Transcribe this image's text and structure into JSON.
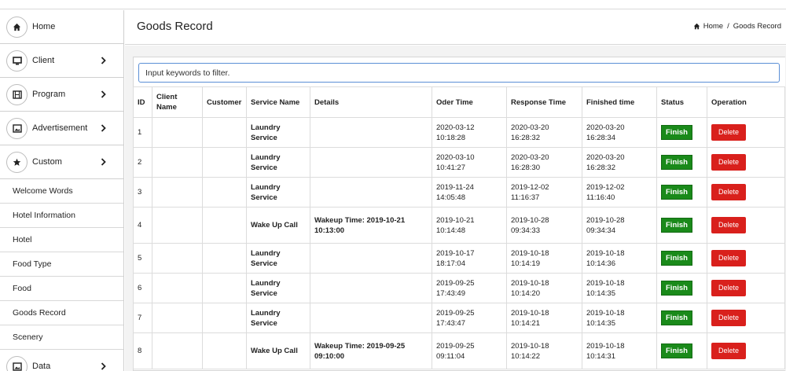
{
  "sidebar": {
    "main_items": [
      {
        "label": "Home",
        "icon": "home-icon"
      },
      {
        "label": "Client",
        "icon": "monitor-icon"
      },
      {
        "label": "Program",
        "icon": "film-icon"
      },
      {
        "label": "Advertisement",
        "icon": "image-icon"
      },
      {
        "label": "Custom",
        "icon": "star-icon"
      }
    ],
    "sub_items": [
      "Welcome Words",
      "Hotel Information",
      "Hotel",
      "Food Type",
      "Food",
      "Goods Record",
      "Scenery"
    ],
    "data_item": {
      "label": "Data",
      "icon": "chart-icon"
    }
  },
  "header": {
    "title": "Goods Record",
    "breadcrumb": {
      "home": "Home",
      "separator": "/",
      "current": "Goods Record"
    }
  },
  "filter": {
    "placeholder": "Input keywords to filter."
  },
  "table": {
    "headers": {
      "id": "ID",
      "client_name": "Client Name",
      "customer": "Customer",
      "service_name": "Service Name",
      "details": "Details",
      "oder_time": "Oder Time",
      "response_time": "Response Time",
      "finished_time": "Finished time",
      "status": "Status",
      "operation": "Operation"
    },
    "rows": [
      {
        "id": "1",
        "client": "",
        "customer": "",
        "service": "Laundry Service",
        "details": "",
        "oder": "2020-03-12 10:18:28",
        "response": "2020-03-20 16:28:32",
        "finished": "2020-03-20 16:28:34",
        "status": "Finish",
        "operation": "Delete"
      },
      {
        "id": "2",
        "client": "",
        "customer": "",
        "service": "Laundry Service",
        "details": "",
        "oder": "2020-03-10 10:41:27",
        "response": "2020-03-20 16:28:30",
        "finished": "2020-03-20 16:28:32",
        "status": "Finish",
        "operation": "Delete"
      },
      {
        "id": "3",
        "client": "",
        "customer": "",
        "service": "Laundry Service",
        "details": "",
        "oder": "2019-11-24 14:05:48",
        "response": "2019-12-02 11:16:37",
        "finished": "2019-12-02 11:16:40",
        "status": "Finish",
        "operation": "Delete"
      },
      {
        "id": "4",
        "client": "",
        "customer": "",
        "service": "Wake Up Call",
        "details": "Wakeup Time: 2019-10-21 10:13:00",
        "oder": "2019-10-21 10:14:48",
        "response": "2019-10-28 09:34:33",
        "finished": "2019-10-28 09:34:34",
        "status": "Finish",
        "operation": "Delete"
      },
      {
        "id": "5",
        "client": "",
        "customer": "",
        "service": "Laundry Service",
        "details": "",
        "oder": "2019-10-17 18:17:04",
        "response": "2019-10-18 10:14:19",
        "finished": "2019-10-18 10:14:36",
        "status": "Finish",
        "operation": "Delete"
      },
      {
        "id": "6",
        "client": "",
        "customer": "",
        "service": "Laundry Service",
        "details": "",
        "oder": "2019-09-25 17:43:49",
        "response": "2019-10-18 10:14:20",
        "finished": "2019-10-18 10:14:35",
        "status": "Finish",
        "operation": "Delete"
      },
      {
        "id": "7",
        "client": "",
        "customer": "",
        "service": "Laundry Service",
        "details": "",
        "oder": "2019-09-25 17:43:47",
        "response": "2019-10-18 10:14:21",
        "finished": "2019-10-18 10:14:35",
        "status": "Finish",
        "operation": "Delete"
      },
      {
        "id": "8",
        "client": "",
        "customer": "",
        "service": "Wake Up Call",
        "details": "Wakeup Time: 2019-09-25 09:10:00",
        "oder": "2019-09-25 09:11:04",
        "response": "2019-10-18 10:14:22",
        "finished": "2019-10-18 10:14:31",
        "status": "Finish",
        "operation": "Delete"
      }
    ]
  },
  "colors": {
    "finish_badge": "#1a8a1a",
    "delete_button": "#d9201c",
    "filter_border": "#5b8fd6"
  }
}
